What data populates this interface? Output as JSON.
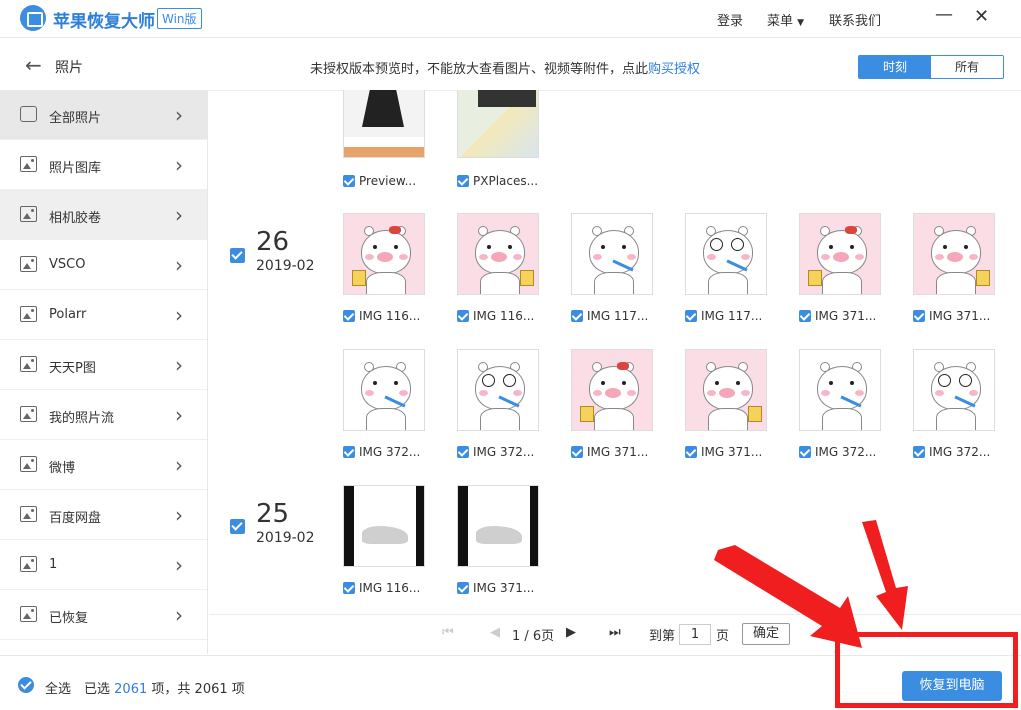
{
  "app": {
    "title": "苹果恢复大师",
    "badge": "Win版",
    "nav": [
      "登录",
      "菜单",
      "联系我们"
    ],
    "win_controls": {
      "minimize": "—",
      "close": "✕"
    }
  },
  "subheader": {
    "title": "照片",
    "notice": "未授权版本预览时，不能放大查看图片、视频等附件，点此",
    "buy_link": "购买授权",
    "view_toggle": [
      {
        "label": "时刻",
        "active": true
      },
      {
        "label": "所有",
        "active": false
      }
    ]
  },
  "sidebar": {
    "items": [
      {
        "label": "全部照片",
        "icon": "document-icon",
        "state": "active"
      },
      {
        "label": "照片图库",
        "icon": "image-icon"
      },
      {
        "label": "相机胶卷",
        "icon": "image-icon",
        "state": "hover"
      },
      {
        "label": "VSCO",
        "icon": "image-icon"
      },
      {
        "label": "Polarr",
        "icon": "image-icon"
      },
      {
        "label": "天天P图",
        "icon": "image-icon"
      },
      {
        "label": "我的照片流",
        "icon": "image-icon"
      },
      {
        "label": "微博",
        "icon": "image-icon"
      },
      {
        "label": "百度网盘",
        "icon": "image-icon"
      },
      {
        "label": "1",
        "icon": "image-icon"
      },
      {
        "label": "已恢复",
        "icon": "image-icon"
      }
    ]
  },
  "groups": [
    {
      "day": "",
      "ym": "",
      "items": [
        "Preview...",
        "PXPlaces..."
      ]
    },
    {
      "day": "26",
      "ym": "2019-02",
      "items": [
        "IMG 116...",
        "IMG 116...",
        "IMG 117...",
        "IMG 117...",
        "IMG 371...",
        "IMG 371...",
        "IMG 372...",
        "IMG 372...",
        "IMG 371...",
        "IMG 371...",
        "IMG 372...",
        "IMG 372..."
      ]
    },
    {
      "day": "25",
      "ym": "2019-02",
      "items": [
        "IMG 116...",
        "IMG 371..."
      ]
    }
  ],
  "pager": {
    "page_info": "1 / 6页",
    "goto_prefix": "到第",
    "goto_value": "1",
    "goto_suffix": "页",
    "confirm": "确定"
  },
  "footer": {
    "select_all": "全选",
    "selected_prefix": "已选",
    "selected_count": "2061",
    "mid": "项，共",
    "total": "2061",
    "suffix": "项",
    "recover_button": "恢复到电脑"
  },
  "colors": {
    "accent": "#3a8de0",
    "annotation": "#f01e1e"
  }
}
